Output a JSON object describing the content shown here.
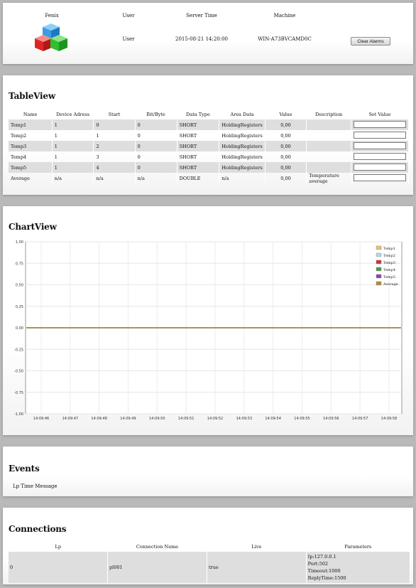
{
  "header": {
    "brand": "Fenix",
    "user_label": "User",
    "user_value": "User",
    "server_time_label": "Server Time",
    "server_time_value": "2015-08-21 14:20:00",
    "machine_label": "Machine",
    "machine_value": "WIN-A73BVCAMD0C",
    "clear_alarms_label": "Clear Alarms"
  },
  "tableview": {
    "title": "TableView",
    "columns": [
      "Name",
      "Device Adress",
      "Start",
      "Bit/Byte",
      "Data Type",
      "Area Data",
      "Value",
      "Description",
      "Set Value"
    ],
    "rows": [
      {
        "name": "Temp1",
        "device": "1",
        "start": "0",
        "bit": "0",
        "type": "SHORT",
        "area": "HoldingRegisters",
        "value": "0,00",
        "desc": ""
      },
      {
        "name": "Temp2",
        "device": "1",
        "start": "1",
        "bit": "0",
        "type": "SHORT",
        "area": "HoldingRegisters",
        "value": "0,00",
        "desc": ""
      },
      {
        "name": "Temp3",
        "device": "1",
        "start": "2",
        "bit": "0",
        "type": "SHORT",
        "area": "HoldingRegisters",
        "value": "0,00",
        "desc": ""
      },
      {
        "name": "Temp4",
        "device": "1",
        "start": "3",
        "bit": "0",
        "type": "SHORT",
        "area": "HoldingRegisters",
        "value": "0,00",
        "desc": ""
      },
      {
        "name": "Temp5",
        "device": "1",
        "start": "4",
        "bit": "0",
        "type": "SHORT",
        "area": "HoldingRegisters",
        "value": "0,00",
        "desc": ""
      },
      {
        "name": "Average",
        "device": "n/a",
        "start": "n/a",
        "bit": "n/a",
        "type": "DOUBLE",
        "area": "n/a",
        "value": "0,00",
        "desc": "Temperature average"
      }
    ]
  },
  "chart_data": {
    "type": "line",
    "title": "ChartView",
    "xlabel": "",
    "ylabel": "",
    "ylim": [
      -1.0,
      1.0
    ],
    "yticks": [
      "1.00",
      "0.75",
      "0.50",
      "0.25",
      "0.00",
      "-0.25",
      "-0.50",
      "-0.75",
      "-1.00"
    ],
    "categories": [
      "14:09:46",
      "14:09:47",
      "14:09:48",
      "14:09:49",
      "14:09:50",
      "14:09:51",
      "14:09:52",
      "14:09:53",
      "14:09:54",
      "14:09:55",
      "14:09:56",
      "14:09:57",
      "14:09:58"
    ],
    "grid": true,
    "legend_position": "top-right",
    "series": [
      {
        "name": "Temp1",
        "color": "#e8c070",
        "values": [
          0,
          0,
          0,
          0,
          0,
          0,
          0,
          0,
          0,
          0,
          0,
          0,
          0
        ]
      },
      {
        "name": "Temp2",
        "color": "#b8d4ea",
        "values": [
          0,
          0,
          0,
          0,
          0,
          0,
          0,
          0,
          0,
          0,
          0,
          0,
          0
        ]
      },
      {
        "name": "Temp3",
        "color": "#cc3333",
        "values": [
          0,
          0,
          0,
          0,
          0,
          0,
          0,
          0,
          0,
          0,
          0,
          0,
          0
        ]
      },
      {
        "name": "Temp4",
        "color": "#4a9a4a",
        "values": [
          0,
          0,
          0,
          0,
          0,
          0,
          0,
          0,
          0,
          0,
          0,
          0,
          0
        ]
      },
      {
        "name": "Temp5",
        "color": "#8e44ad",
        "values": [
          0,
          0,
          0,
          0,
          0,
          0,
          0,
          0,
          0,
          0,
          0,
          0,
          0
        ]
      },
      {
        "name": "Average",
        "color": "#b08a3c",
        "values": [
          0,
          0,
          0,
          0,
          0,
          0,
          0,
          0,
          0,
          0,
          0,
          0,
          0
        ]
      }
    ]
  },
  "events": {
    "title": "Events",
    "columns_text": "Lp Time Message"
  },
  "connections": {
    "title": "Connections",
    "columns": [
      "Lp",
      "Connection Name",
      "Live",
      "Parameters"
    ],
    "rows": [
      {
        "lp": "0",
        "name": "pl001",
        "live": "true",
        "params": [
          "Ip:127.0.0.1",
          "Port:502",
          "Timeout:1000",
          "ReplyTime:1500"
        ]
      }
    ]
  }
}
